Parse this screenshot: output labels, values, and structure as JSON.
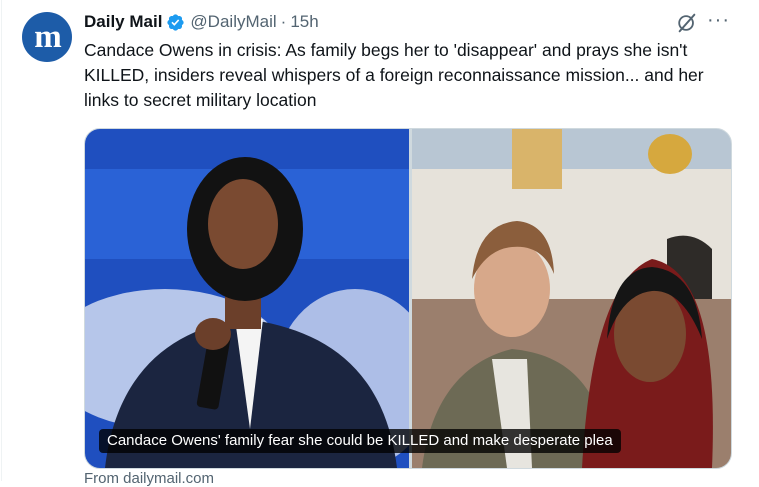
{
  "author": {
    "avatar_text": "m",
    "name": "Daily Mail",
    "handle": "@DailyMail",
    "separator": "·",
    "time": "15h"
  },
  "actions": {
    "grok_icon": "grok-icon",
    "more_label": "···"
  },
  "tweet": {
    "text": "Candace Owens in crisis: As family begs her to 'disappear' and prays she isn't KILLED, insiders reveal whispers of a foreign reconnaissance mission... and her links to secret military location"
  },
  "media": {
    "caption": "Candace Owens' family fear she could be KILLED and make desperate plea"
  },
  "card": {
    "source": "From dailymail.com"
  },
  "colors": {
    "avatar_bg": "#1d5ca8",
    "verified": "#1d9bf0",
    "secondary_text": "#536471",
    "border": "#cfd9de"
  }
}
